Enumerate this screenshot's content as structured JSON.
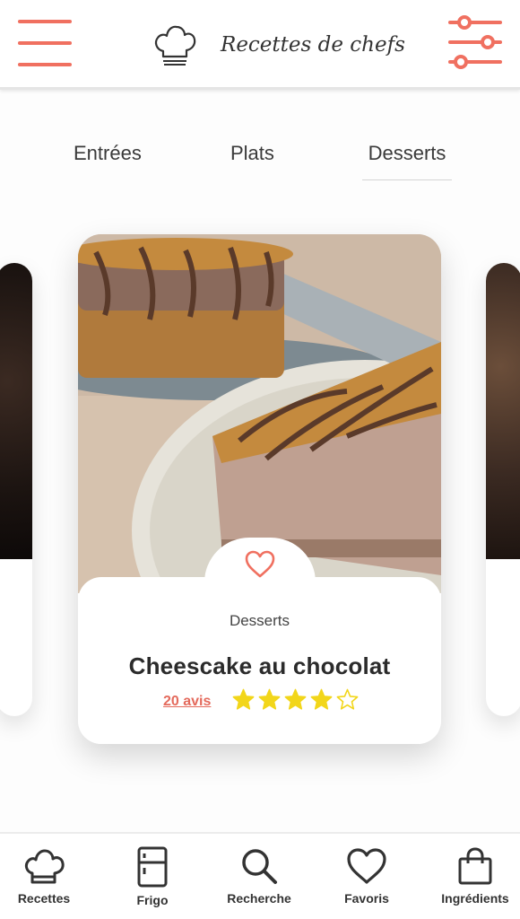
{
  "header": {
    "app_title": "Recettes de chefs",
    "menu_icon": "hamburger-menu-icon",
    "logo_icon": "chef-hat-icon",
    "filter_icon": "sliders-filter-icon",
    "accent_color": "#f07060"
  },
  "tabs": [
    {
      "label": "Entrées",
      "active": false
    },
    {
      "label": "Plats",
      "active": false
    },
    {
      "label": "Desserts",
      "active": true
    }
  ],
  "card": {
    "category": "Desserts",
    "title": "Cheescake au chocolat",
    "reviews": "20 avis",
    "rating": 4,
    "rating_max": 5,
    "favorite_icon": "heart-outline-icon",
    "star_color": "#f2d61a"
  },
  "bottom_nav": [
    {
      "label": "Recettes",
      "icon": "chef-hat-icon"
    },
    {
      "label": "Frigo",
      "icon": "fridge-icon"
    },
    {
      "label": "Recherche",
      "icon": "search-icon"
    },
    {
      "label": "Favoris",
      "icon": "heart-icon"
    },
    {
      "label": "Ingrédients",
      "icon": "shopping-bag-icon"
    }
  ]
}
